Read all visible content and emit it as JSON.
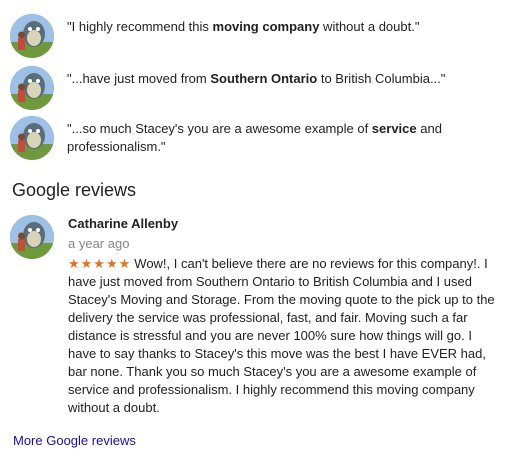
{
  "snippets": [
    {
      "before": "\"I highly recommend this ",
      "bold": "moving company",
      "after": " without a doubt.\""
    },
    {
      "before": "\"...have just moved from ",
      "bold": "Southern Ontario",
      "after": " to British Columbia...\""
    },
    {
      "before": "\"...so much Stacey's you are a awesome example of ",
      "bold": "service",
      "after": " and professionalism.\""
    }
  ],
  "heading": "Google reviews",
  "review": {
    "name": "Catharine Allenby",
    "date": "a year ago",
    "stars": "★★★★★",
    "rating": 5,
    "text": "Wow!, I can't believe there are no reviews for this company!. I have just moved from Southern Ontario to British Columbia and I used Stacey's Moving and Storage. From the moving quote to the pick up to the delivery the service was professional, fast, and fair. Moving such a far distance is stressful and you are never 100% sure how things will go. I have to say thanks to Stacey's this move was the best I have EVER had, bar none. Thank you so much Stacey's you are a awesome example of service and professionalism. I highly recommend this moving company without a doubt."
  },
  "more_link": "More Google reviews",
  "colors": {
    "star": "#e7711b",
    "link": "#1a0dab",
    "date": "#878787"
  }
}
